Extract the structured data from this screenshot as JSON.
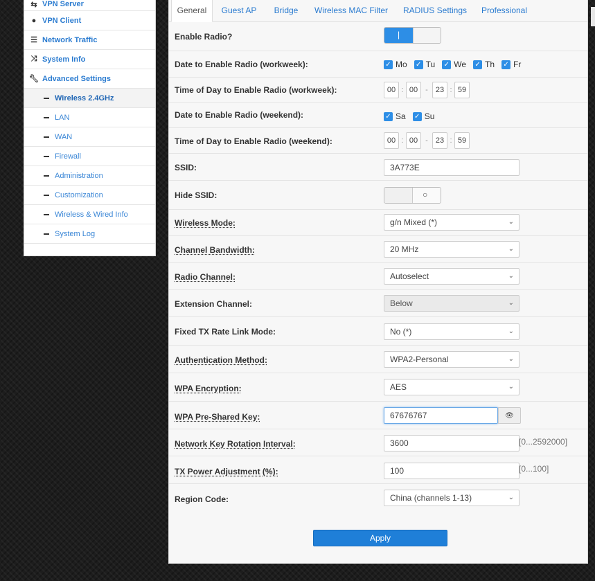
{
  "sidebar": {
    "items": [
      {
        "label": "VPN Server",
        "icon": "vpn-server-icon"
      },
      {
        "label": "VPN Client",
        "icon": "globe-icon"
      },
      {
        "label": "Network Traffic",
        "icon": "traffic-icon"
      },
      {
        "label": "System Info",
        "icon": "shuffle-icon"
      },
      {
        "label": "Advanced Settings",
        "icon": "wrench-icon"
      }
    ],
    "sub_items": [
      {
        "label": "Wireless 2.4GHz"
      },
      {
        "label": "LAN"
      },
      {
        "label": "WAN"
      },
      {
        "label": "Firewall"
      },
      {
        "label": "Administration"
      },
      {
        "label": "Customization"
      },
      {
        "label": "Wireless & Wired Info"
      },
      {
        "label": "System Log"
      }
    ]
  },
  "tabs": [
    "General",
    "Guest AP",
    "Bridge",
    "Wireless MAC Filter",
    "RADIUS Settings",
    "Professional"
  ],
  "form": {
    "enable_radio": {
      "label": "Enable Radio?",
      "state": "on"
    },
    "workweek_days": {
      "label": "Date to Enable Radio (workweek):",
      "days": [
        "Mo",
        "Tu",
        "We",
        "Th",
        "Fr"
      ]
    },
    "workweek_time": {
      "label": "Time of Day to Enable Radio (workweek):",
      "start_h": "00",
      "start_m": "00",
      "dash": "-",
      "end_h": "23",
      "end_m": "59"
    },
    "weekend_days": {
      "label": "Date to Enable Radio (weekend):",
      "days": [
        "Sa",
        "Su"
      ]
    },
    "weekend_time": {
      "label": "Time of Day to Enable Radio (weekend):",
      "start_h": "00",
      "start_m": "00",
      "dash": "-",
      "end_h": "23",
      "end_m": "59"
    },
    "ssid": {
      "label": "SSID:",
      "value": "3A773E"
    },
    "hide_ssid": {
      "label": "Hide SSID:",
      "state": "off"
    },
    "wireless_mode": {
      "label": "Wireless Mode:",
      "value": "g/n Mixed (*)"
    },
    "channel_bandwidth": {
      "label": "Channel Bandwidth:",
      "value": "20 MHz"
    },
    "radio_channel": {
      "label": "Radio Channel:",
      "value": "Autoselect"
    },
    "extension_channel": {
      "label": "Extension Channel:",
      "value": "Below"
    },
    "fixed_tx": {
      "label": "Fixed TX Rate Link Mode:",
      "value": "No (*)"
    },
    "auth_method": {
      "label": "Authentication Method:",
      "value": "WPA2-Personal"
    },
    "wpa_encryption": {
      "label": "WPA Encryption:",
      "value": "AES"
    },
    "wpa_psk": {
      "label": "WPA Pre-Shared Key:",
      "value": "67676767"
    },
    "key_rotation": {
      "label": "Network Key Rotation Interval:",
      "value": "3600",
      "hint": "[0...2592000]"
    },
    "tx_power": {
      "label": "TX Power Adjustment (%):",
      "value": "100",
      "hint": "[0...100]"
    },
    "region_code": {
      "label": "Region Code:",
      "value": "China (channels 1-13)"
    }
  },
  "apply_label": "Apply",
  "colors": {
    "accent": "#2d8ee6",
    "link": "#2a7bd0",
    "button": "#1f7fd8"
  }
}
